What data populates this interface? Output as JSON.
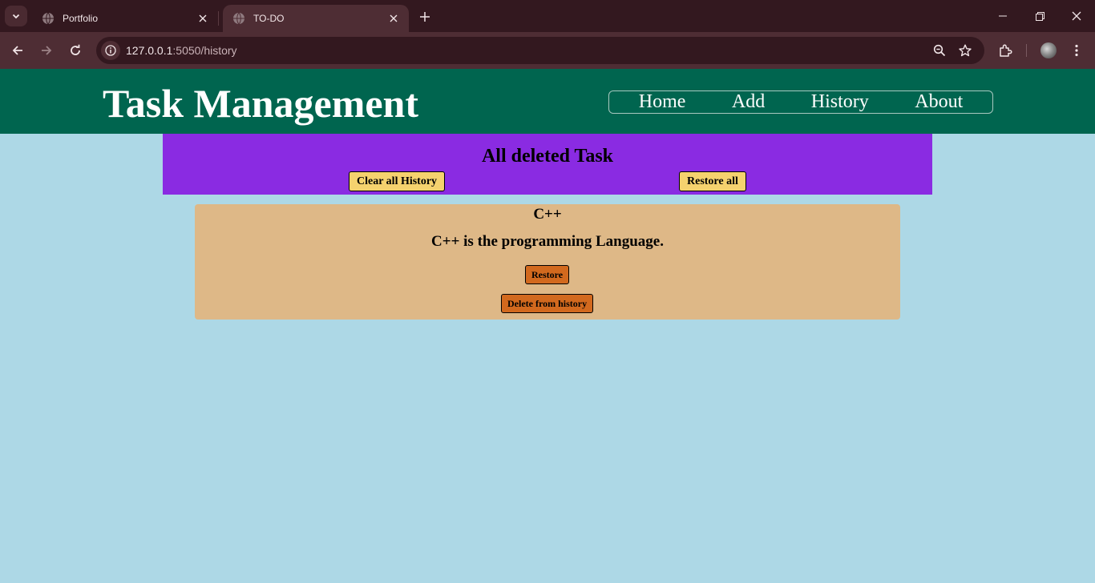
{
  "browser": {
    "tabs": [
      {
        "title": "Portfolio",
        "active": false
      },
      {
        "title": "TO-DO",
        "active": true
      }
    ],
    "url_host": "127.0.0.1",
    "url_path": ":5050/history"
  },
  "header": {
    "title": "Task Management",
    "nav": [
      "Home",
      "Add",
      "History",
      "About"
    ]
  },
  "history": {
    "title": "All deleted Task",
    "clear_label": "Clear all History",
    "restore_all_label": "Restore all"
  },
  "tasks": [
    {
      "title": "C++",
      "description": "C++ is the programming Language.",
      "restore_label": "Restore",
      "delete_label": "Delete from history"
    }
  ],
  "colors": {
    "header_bg": "#00654f",
    "banner_bg": "#8a2be2",
    "page_bg": "#add8e6",
    "card_bg": "#deb887",
    "yellow_button": "#f5d26e",
    "orange_button": "#d2691e"
  }
}
